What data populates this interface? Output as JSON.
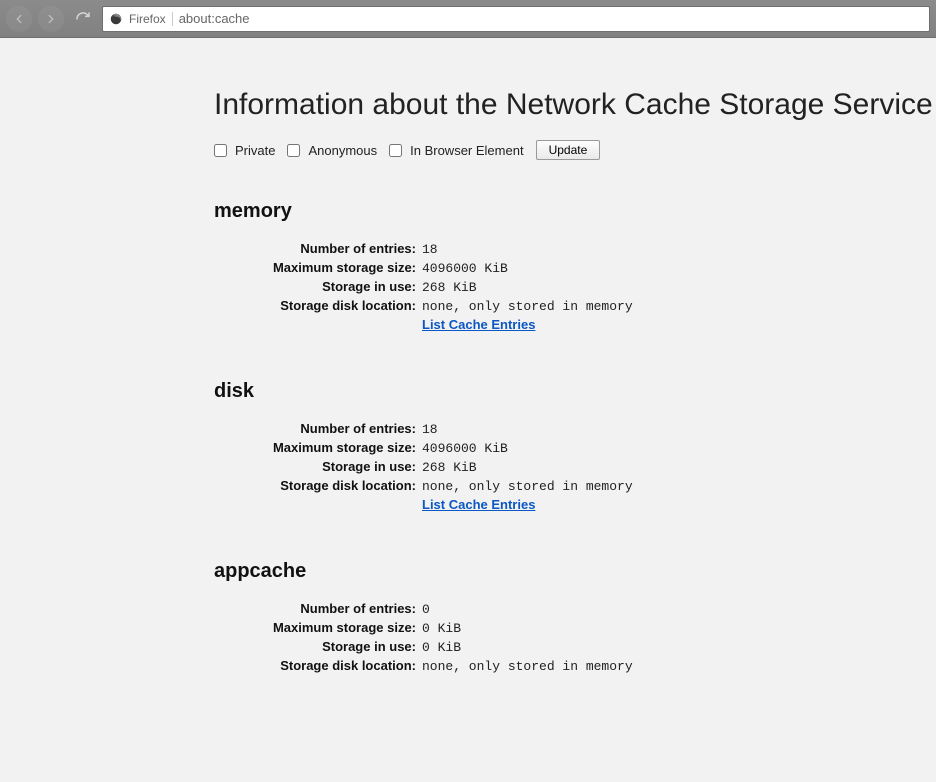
{
  "toolbar": {
    "identity_label": "Firefox",
    "url": "about:cache"
  },
  "page": {
    "title": "Information about the Network Cache Storage Service"
  },
  "controls": {
    "private_label": "Private",
    "anonymous_label": "Anonymous",
    "inbrowser_label": "In Browser Element",
    "update_label": "Update"
  },
  "labels": {
    "num_entries": "Number of entries:",
    "max_storage": "Maximum storage size:",
    "storage_in_use": "Storage in use:",
    "storage_loc": "Storage disk location:",
    "list_entries": "List Cache Entries"
  },
  "sections": {
    "memory": {
      "title": "memory",
      "num_entries": "18",
      "max_storage": "4096000 KiB",
      "storage_in_use": "268 KiB",
      "storage_loc": "none, only stored in memory",
      "has_link": true
    },
    "disk": {
      "title": "disk",
      "num_entries": "18",
      "max_storage": "4096000 KiB",
      "storage_in_use": "268 KiB",
      "storage_loc": "none, only stored in memory",
      "has_link": true
    },
    "appcache": {
      "title": "appcache",
      "num_entries": "0",
      "max_storage": "0 KiB",
      "storage_in_use": "0 KiB",
      "storage_loc": "none, only stored in memory",
      "has_link": false
    }
  }
}
